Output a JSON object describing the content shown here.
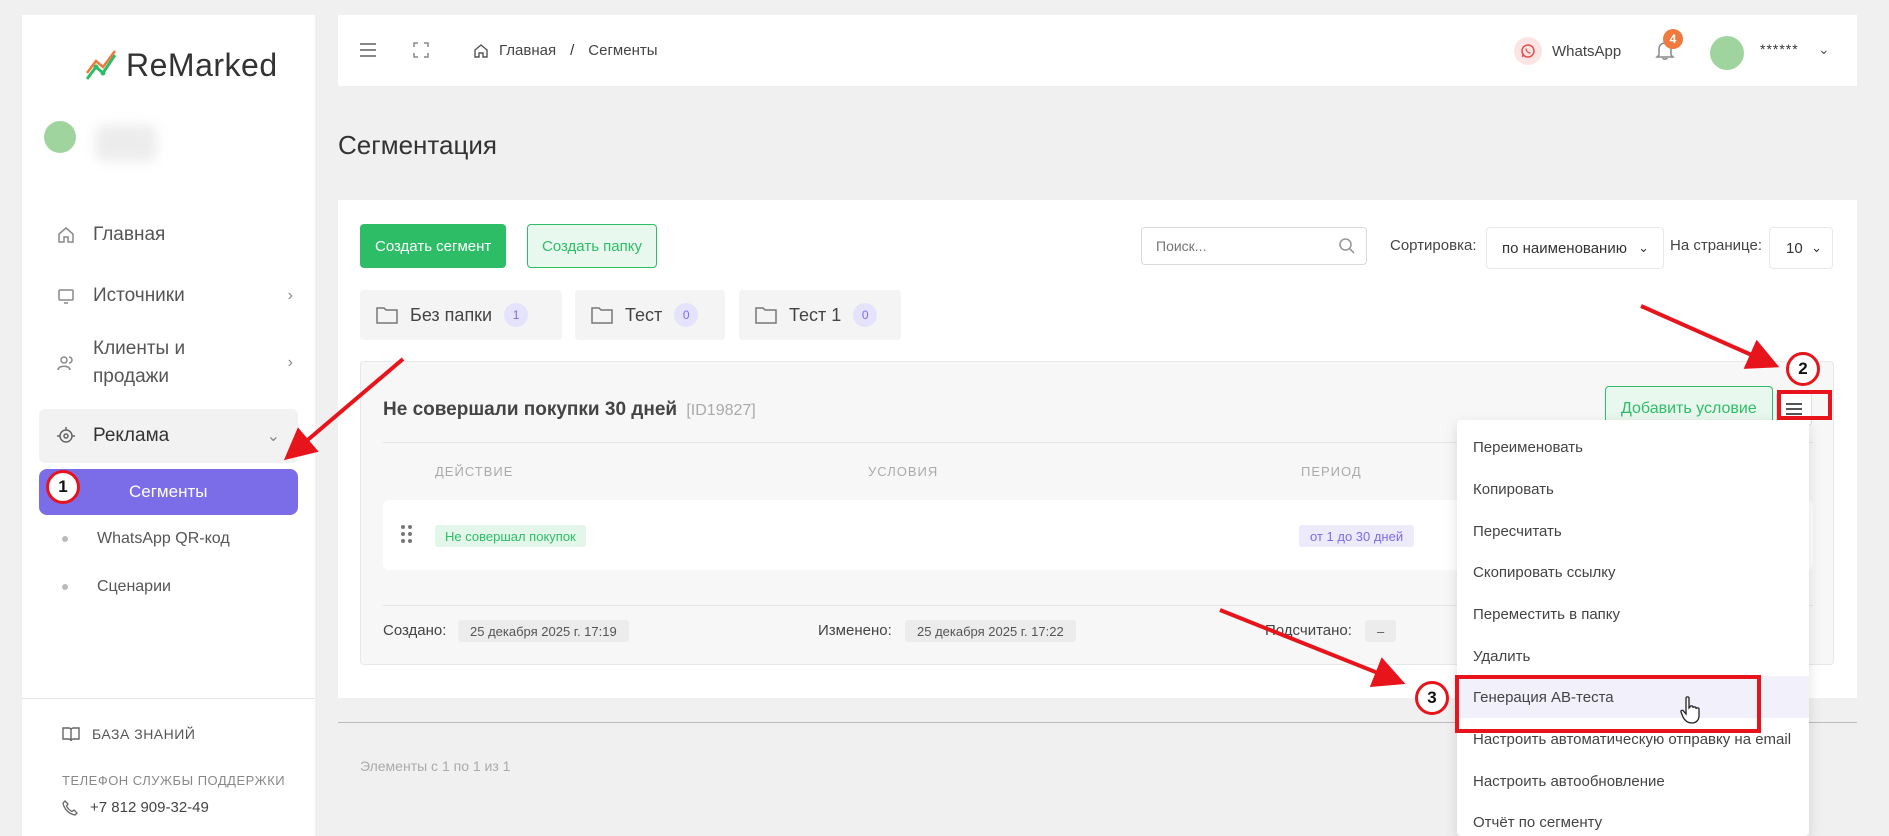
{
  "brand": {
    "name": "ReMarked"
  },
  "sidebar": {
    "items": [
      {
        "label": "Главная",
        "icon": "home-icon"
      },
      {
        "label": "Источники",
        "icon": "monitor-icon"
      },
      {
        "label_line1": "Клиенты и",
        "label_line2": "продажи",
        "icon": "users-icon"
      },
      {
        "label": "Реклама",
        "icon": "target-icon"
      }
    ],
    "sub_items": [
      {
        "label": "Сегменты",
        "active": true
      },
      {
        "label": "WhatsApp QR-код"
      },
      {
        "label": "Сценарии"
      }
    ],
    "knowledge_base": "БАЗА ЗНАНИЙ",
    "support_label": "ТЕЛЕФОН СЛУЖБЫ ПОДДЕРЖКИ",
    "support_phone": "+7 812 909-32-49"
  },
  "header": {
    "breadcrumb": [
      "Главная",
      "Сегменты"
    ],
    "breadcrumb_sep": "/",
    "whatsapp_label": "WhatsApp",
    "notifications_count": "4",
    "user_name": "******"
  },
  "page": {
    "title": "Сегментация"
  },
  "toolbar": {
    "create_segment": "Создать сегмент",
    "create_folder": "Создать папку",
    "search_placeholder": "Поиск...",
    "sort_label": "Сортировка:",
    "sort_value": "по наименованию",
    "per_page_label": "На странице:",
    "per_page_value": "10"
  },
  "folders": [
    {
      "name": "Без папки",
      "count": "1"
    },
    {
      "name": "Тест",
      "count": "0"
    },
    {
      "name": "Тест 1",
      "count": "0"
    }
  ],
  "segment": {
    "title": "Не совершали покупки 30 дней",
    "id": "[ID19827]",
    "add_condition": "Добавить условие",
    "columns": [
      "ДЕЙСТВИЕ",
      "УСЛОВИЯ",
      "ПЕРИОД"
    ],
    "row": {
      "action": "Не совершал покупок",
      "period": "от 1 до 30 дней"
    },
    "created_label": "Создано:",
    "created_value": "25 декабря 2025 г. 17:19",
    "modified_label": "Изменено:",
    "modified_value": "25 декабря 2025 г. 17:22",
    "counted_label": "Подсчитано:",
    "counted_value": "–"
  },
  "footer": {
    "pagination_text": "Элементы с 1 по 1 из 1"
  },
  "menu": {
    "items": [
      "Переименовать",
      "Копировать",
      "Пересчитать",
      "Скопировать ссылку",
      "Переместить в папку",
      "Удалить",
      "Генерация AB-теста",
      "Настроить автоматическую отправку на email",
      "Настроить автообновление",
      "Отчёт по сегменту"
    ],
    "highlighted": "Генерация AB-теста"
  },
  "annotations": {
    "steps": [
      "1",
      "2",
      "3"
    ],
    "color": "#e8141b"
  },
  "colors": {
    "accent_purple": "#7b6ce8",
    "accent_green": "#2ebd67",
    "badge_orange": "#f07a3e"
  }
}
